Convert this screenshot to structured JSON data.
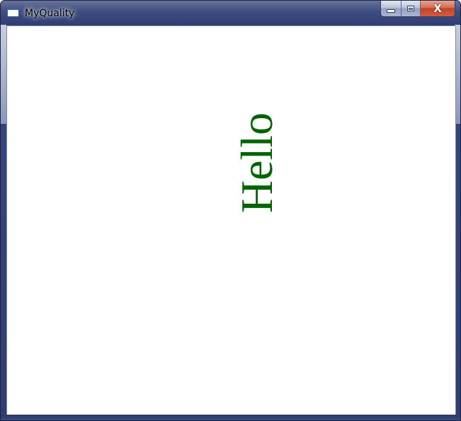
{
  "window": {
    "title": "MyQuality",
    "icon": "app-window-icon",
    "caption_buttons": {
      "minimize_icon": "minimize-icon",
      "maximize_icon": "maximize-icon",
      "close_icon": "close-icon",
      "close_glyph": "X"
    },
    "frame_color": "#2e3d73",
    "close_button_color": "#c0432a"
  },
  "client": {
    "background": "#ffffff",
    "text": "Hello",
    "text_color": "#006400",
    "text_orientation": "rotated 90 degrees counter-clockwise"
  }
}
